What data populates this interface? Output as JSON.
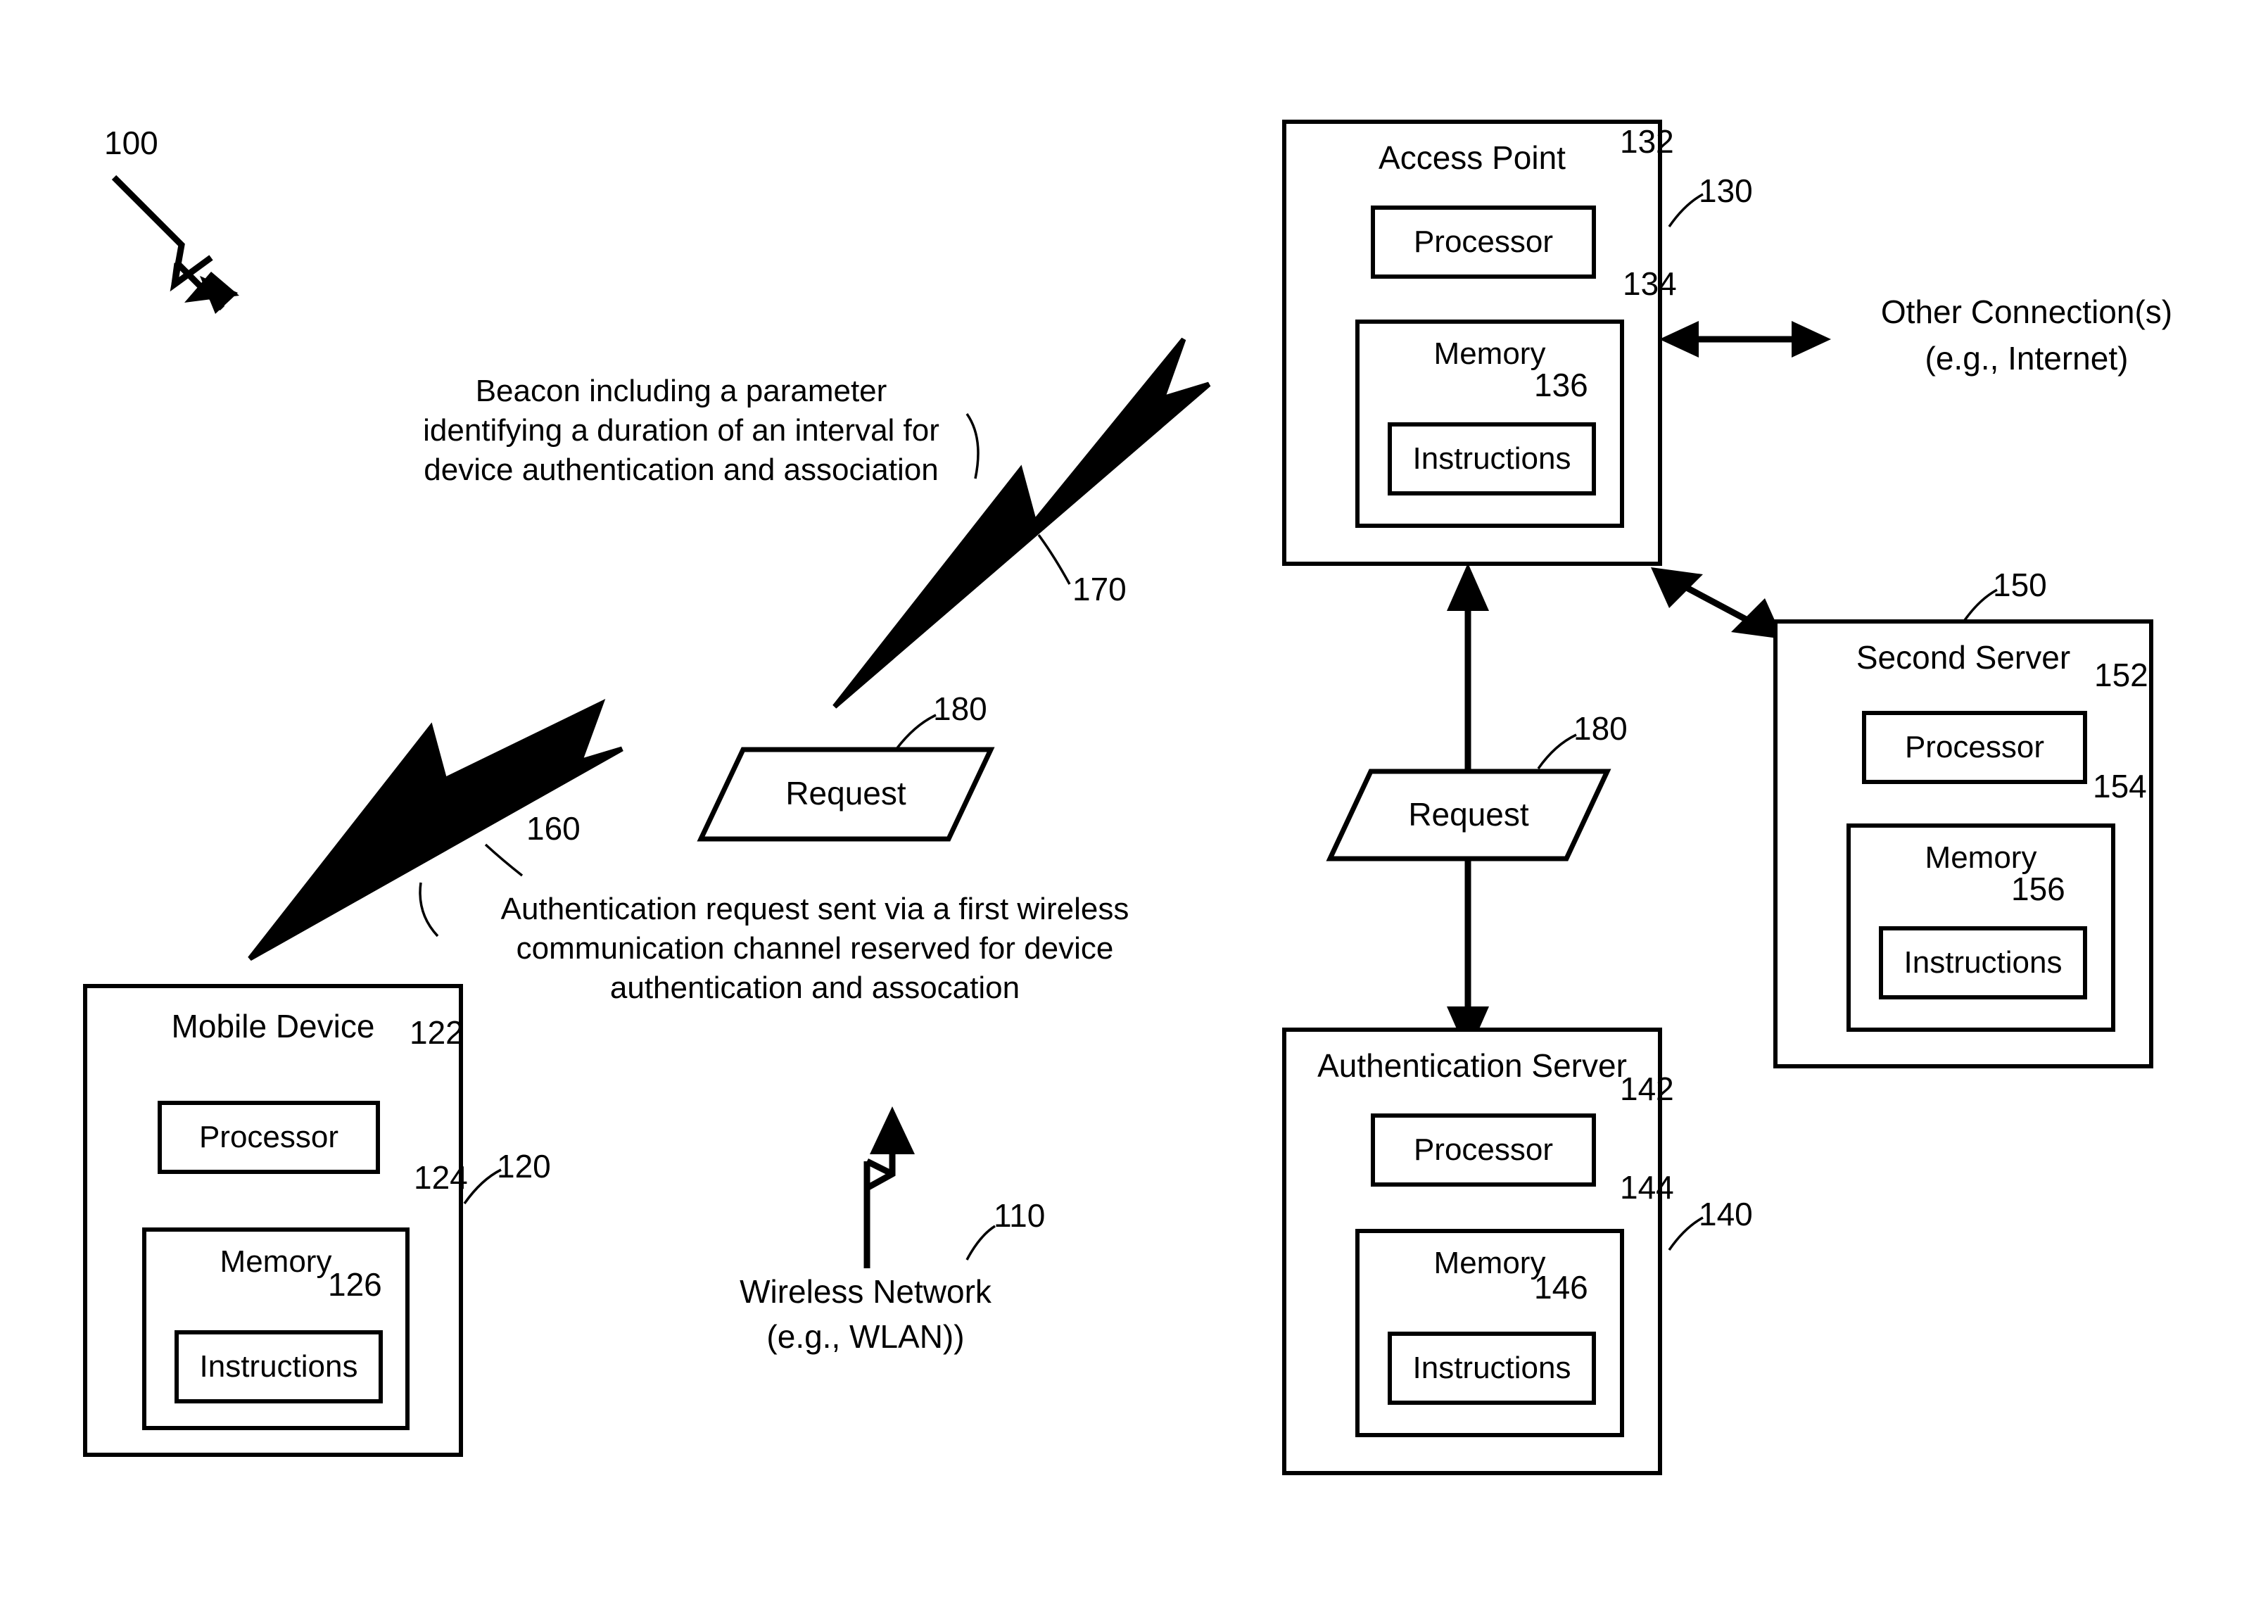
{
  "figure": {
    "system_ref": "100",
    "network": {
      "label_line1": "Wireless Network",
      "label_line2": "(e.g., WLAN))",
      "ref": "110"
    },
    "other_connections": {
      "line1": "Other Connection(s)",
      "line2": "(e.g., Internet)"
    },
    "messages": {
      "beacon_text": "Beacon including a parameter\nidentifying a duration of an interval for\ndevice authentication and association",
      "beacon_ref": "170",
      "auth_request_text": "Authentication request sent via a first wireless\ncommunication channel reserved for device\nauthentication and assocation",
      "auth_request_ref": "160",
      "request_label": "Request",
      "request_ref": "180"
    },
    "nodes": [
      {
        "id": "mobile-device",
        "title": "Mobile Device",
        "ref": "120",
        "processor": {
          "label": "Processor",
          "ref": "122"
        },
        "memory": {
          "label": "Memory",
          "ref": "124"
        },
        "instructions": {
          "label": "Instructions",
          "ref": "126"
        }
      },
      {
        "id": "access-point",
        "title": "Access Point",
        "ref": "130",
        "processor": {
          "label": "Processor",
          "ref": "132"
        },
        "memory": {
          "label": "Memory",
          "ref": "134"
        },
        "instructions": {
          "label": "Instructions",
          "ref": "136"
        }
      },
      {
        "id": "authentication-server",
        "title": "Authentication Server",
        "ref": "140",
        "processor": {
          "label": "Processor",
          "ref": "142"
        },
        "memory": {
          "label": "Memory",
          "ref": "144"
        },
        "instructions": {
          "label": "Instructions",
          "ref": "146"
        }
      },
      {
        "id": "second-server",
        "title": "Second Server",
        "ref": "150",
        "processor": {
          "label": "Processor",
          "ref": "152"
        },
        "memory": {
          "label": "Memory",
          "ref": "154"
        },
        "instructions": {
          "label": "Instructions",
          "ref": "156"
        }
      }
    ],
    "colors": {
      "ink": "#000000",
      "paper": "#ffffff"
    }
  }
}
